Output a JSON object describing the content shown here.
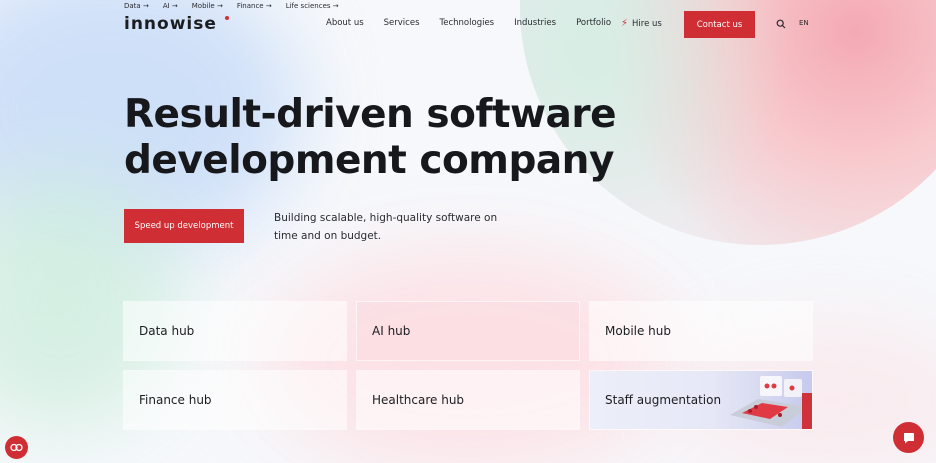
{
  "top_links": [
    "Data →",
    "AI →",
    "Mobile →",
    "Finance →",
    "Life sciences →"
  ],
  "logo": "innowise",
  "nav": [
    "About us",
    "Services",
    "Technologies",
    "Industries",
    "Portfolio"
  ],
  "hire": "Hire us",
  "contact": "Contact us",
  "lang": "EN",
  "hero": {
    "line1": "Result-driven software",
    "line2": "development company",
    "cta": "Speed up development",
    "subtitle": "Building scalable, high-quality software on time and on budget."
  },
  "cards": [
    "Data hub",
    "AI hub",
    "Mobile hub",
    "Finance hub",
    "Healthcare hub",
    "Staff augmentation"
  ],
  "colors": {
    "accent": "#cf2e34"
  },
  "icons": {
    "search": "search-icon",
    "cookie": "cookie-icon",
    "chat": "chat-icon",
    "hire": "lightning-icon"
  }
}
